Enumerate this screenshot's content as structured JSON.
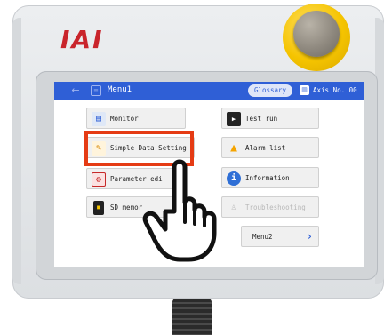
{
  "brand": {
    "logo_text": "IAI"
  },
  "titlebar": {
    "title": "Menu1",
    "glossary_label": "Glossary",
    "axis_label": "Axis No. 00"
  },
  "menu": {
    "left": [
      {
        "label": "Monitor",
        "icon": "monitor-icon"
      },
      {
        "label": "Simple Data Setting",
        "icon": "pencil-icon"
      },
      {
        "label": "Parameter edi",
        "icon": "parameter-icon"
      },
      {
        "label": "SD memor",
        "icon": "sd-card-icon"
      }
    ],
    "right": [
      {
        "label": "Test run",
        "icon": "test-run-icon"
      },
      {
        "label": "Alarm list",
        "icon": "warning-icon"
      },
      {
        "label": "Information",
        "icon": "info-icon"
      },
      {
        "label": "Troubleshooting",
        "icon": "troubleshooting-icon",
        "disabled": true
      },
      {
        "label": "Menu2",
        "icon": "chevron-right-icon"
      }
    ]
  },
  "highlight_color": "#e53b14",
  "accent_color": "#2f5fd6"
}
